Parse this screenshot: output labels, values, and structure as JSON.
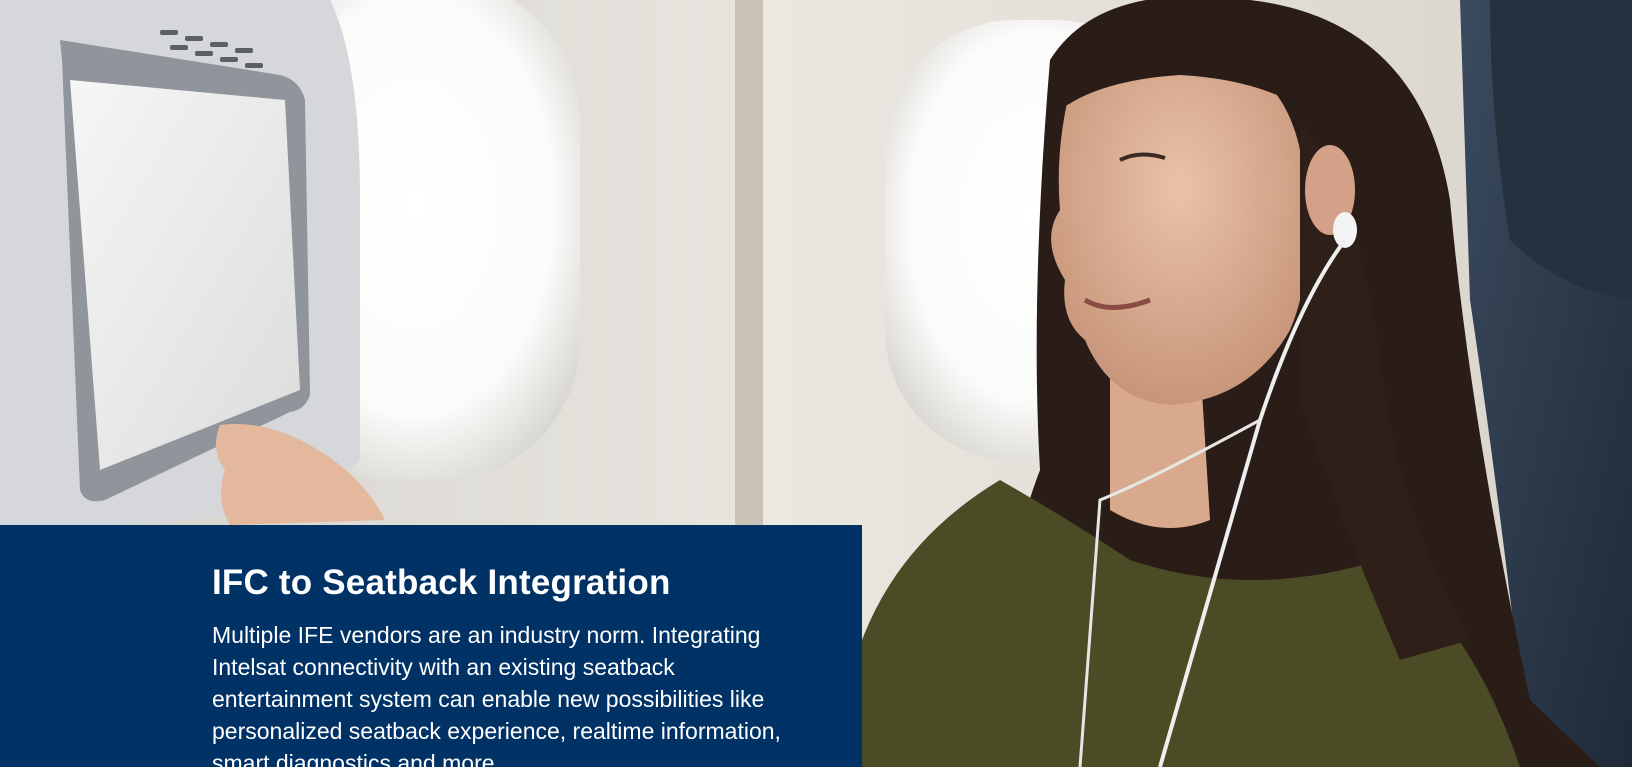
{
  "hero": {
    "image": "passenger-using-seatback-screen-photo",
    "subject": "woman-with-earphones-icon",
    "screen": "seatback-screen-icon"
  },
  "feature": {
    "title": "IFC to Seatback Integration",
    "body": "Multiple IFE vendors are an industry norm. Integrating Intelsat connectivity with an existing seatback entertainment system can enable new possibilities like personalized seatback experience, realtime information, smart diagnostics and more."
  },
  "colors": {
    "panel": "#003266",
    "text": "#ffffff"
  }
}
